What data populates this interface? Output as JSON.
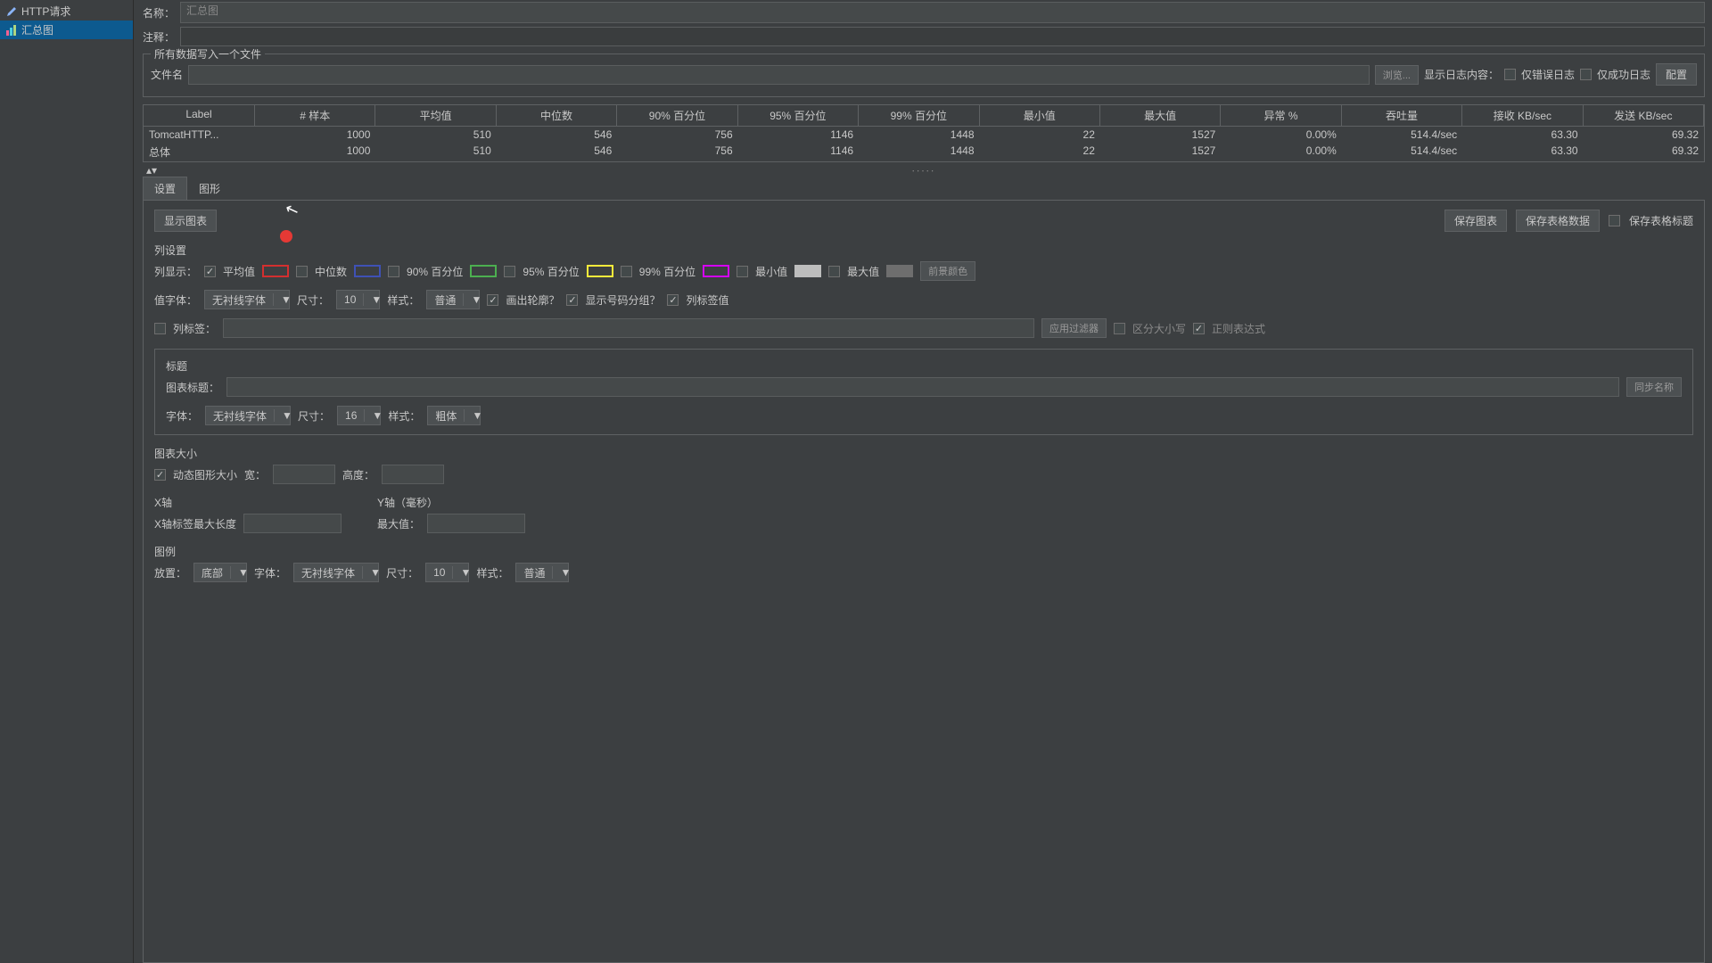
{
  "tree": {
    "http": "HTTP请求",
    "summary": "汇总图"
  },
  "header": {
    "name_label": "名称：",
    "name_value": "汇总图",
    "comment_label": "注释："
  },
  "file_fs": {
    "legend": "所有数据写入一个文件",
    "filename_label": "文件名",
    "browse": "浏览...",
    "log_content": "显示日志内容：",
    "only_err": "仅错误日志",
    "only_ok": "仅成功日志",
    "config": "配置"
  },
  "table": {
    "headers": [
      "Label",
      "# 样本",
      "平均值",
      "中位数",
      "90% 百分位",
      "95% 百分位",
      "99% 百分位",
      "最小值",
      "最大值",
      "异常 %",
      "吞吐量",
      "接收 KB/sec",
      "发送 KB/sec"
    ],
    "rows": [
      [
        "TomcatHTTP...",
        "1000",
        "510",
        "546",
        "756",
        "1146",
        "1448",
        "22",
        "1527",
        "0.00%",
        "514.4/sec",
        "63.30",
        "69.32"
      ],
      [
        "总体",
        "1000",
        "510",
        "546",
        "756",
        "1146",
        "1448",
        "22",
        "1527",
        "0.00%",
        "514.4/sec",
        "63.30",
        "69.32"
      ]
    ]
  },
  "tabs": {
    "settings": "设置",
    "graph": "图形"
  },
  "actions": {
    "show_chart": "显示图表",
    "save_chart": "保存图表",
    "save_table": "保存表格数据",
    "save_headers": "保存表格标题"
  },
  "cols": {
    "title": "列设置",
    "display": "列显示：",
    "avg": "平均值",
    "median": "中位数",
    "p90": "90% 百分位",
    "p95": "95% 百分位",
    "p99": "99% 百分位",
    "min": "最小值",
    "max": "最大值",
    "fgcolor": "前景颜色",
    "value_font": "值字体：",
    "font_sans": "无衬线字体",
    "size": "尺寸：",
    "size10": "10",
    "style": "样式：",
    "style_normal": "普通",
    "outline": "画出轮廓？",
    "shownum": "显示号码分组？",
    "barlabel": "列标签值",
    "col_label": "列标签：",
    "apply_filter": "应用过滤器",
    "case": "区分大小写",
    "regex": "正则表达式"
  },
  "titlebox": {
    "title": "标题",
    "chart_title": "图表标题：",
    "sync": "同步名称",
    "font": "字体：",
    "font_sans": "无衬线字体",
    "size": "尺寸：",
    "size16": "16",
    "style": "样式：",
    "style_bold": "粗体"
  },
  "sizebox": {
    "title": "图表大小",
    "dyn": "动态图形大小",
    "w": "宽：",
    "h": "高度："
  },
  "xaxis": {
    "title": "X轴",
    "maxlen": "X轴标签最大长度"
  },
  "yaxis": {
    "title": "Y轴（毫秒）",
    "max": "最大值："
  },
  "legendbox": {
    "title": "图例",
    "placement": "放置：",
    "bottom": "底部",
    "font": "字体：",
    "font_sans": "无衬线字体",
    "size": "尺寸：",
    "size10": "10",
    "style": "样式：",
    "style_normal": "普通"
  }
}
